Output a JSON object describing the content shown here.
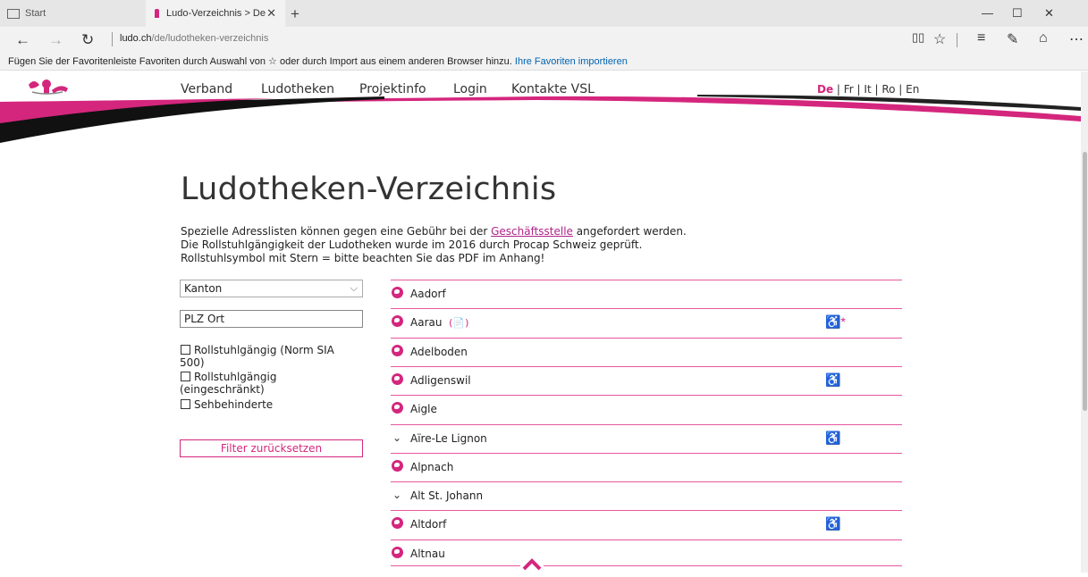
{
  "browser": {
    "tabs": [
      {
        "label": "Start"
      },
      {
        "label": "Ludo-Verzeichnis > De"
      }
    ],
    "new_tab": "+",
    "window_controls": {
      "minimize": "—",
      "maximize": "☐",
      "close": "✕"
    },
    "nav": {
      "back": "←",
      "forward": "→",
      "refresh": "↻"
    },
    "url_host": "ludo.ch",
    "url_path": "/de/ludotheken-verzeichnis",
    "toolbar_icons": [
      "reading-view-icon",
      "favorite-star-icon",
      "hub-icon",
      "web-note-icon",
      "share-icon",
      "more-icon"
    ],
    "favbar_text": "Fügen Sie der Favoritenleiste Favoriten durch Auswahl von ☆ oder durch Import aus einem anderen Browser hinzu.",
    "favbar_link": "Ihre Favoriten importieren"
  },
  "site": {
    "menu": [
      "Verband",
      "Ludotheken",
      "Projektinfo",
      "Login",
      "Kontakte VSL"
    ],
    "lang_active": "De",
    "lang_rest": " | Fr | It | Ro | En",
    "title": "Ludotheken-Verzeichnis",
    "intro": {
      "line1_before": "Spezielle Adresslisten können gegen eine Gebühr bei der ",
      "line1_link": "Geschäftsstelle",
      "line1_after": " angefordert werden.",
      "line2": "Die Rollstuhlgängigkeit der Ludotheken wurde im 2016 durch Procap Schweiz geprüft.",
      "line3": "Rollstuhlsymbol mit Stern = bitte beachten Sie das PDF im Anhang!"
    },
    "filters": {
      "kanton": "Kanton",
      "plz_placeholder": "PLZ Ort",
      "checkboxes": [
        "Rollstuhlgängig (Norm SIA 500)",
        "Rollstuhlgängig (eingeschränkt)",
        "Sehbehinderte"
      ],
      "reset": "Filter zurücksetzen"
    },
    "entries": [
      {
        "name": "Aadorf",
        "icon": "globe-icon",
        "pdf": "",
        "wheelchair": ""
      },
      {
        "name": "Aarau",
        "icon": "globe-icon",
        "pdf": "(📄)",
        "wheelchair": "♿*"
      },
      {
        "name": "Adelboden",
        "icon": "globe-icon",
        "pdf": "",
        "wheelchair": ""
      },
      {
        "name": "Adligenswil",
        "icon": "globe-icon",
        "pdf": "",
        "wheelchair": "♿"
      },
      {
        "name": "Aigle",
        "icon": "globe-icon",
        "pdf": "",
        "wheelchair": ""
      },
      {
        "name": "Aïre-Le Lignon",
        "icon": "chevron-down-icon",
        "pdf": "",
        "wheelchair": "♿"
      },
      {
        "name": "Alpnach",
        "icon": "globe-icon",
        "pdf": "",
        "wheelchair": ""
      },
      {
        "name": "Alt St. Johann",
        "icon": "chevron-down-icon",
        "pdf": "",
        "wheelchair": ""
      },
      {
        "name": "Altdorf",
        "icon": "globe-icon",
        "pdf": "",
        "wheelchair": "♿"
      },
      {
        "name": "Altnau",
        "icon": "globe-icon",
        "pdf": "",
        "wheelchair": ""
      }
    ],
    "colors": {
      "accent": "#d4267d",
      "link": "#0063b1"
    }
  }
}
